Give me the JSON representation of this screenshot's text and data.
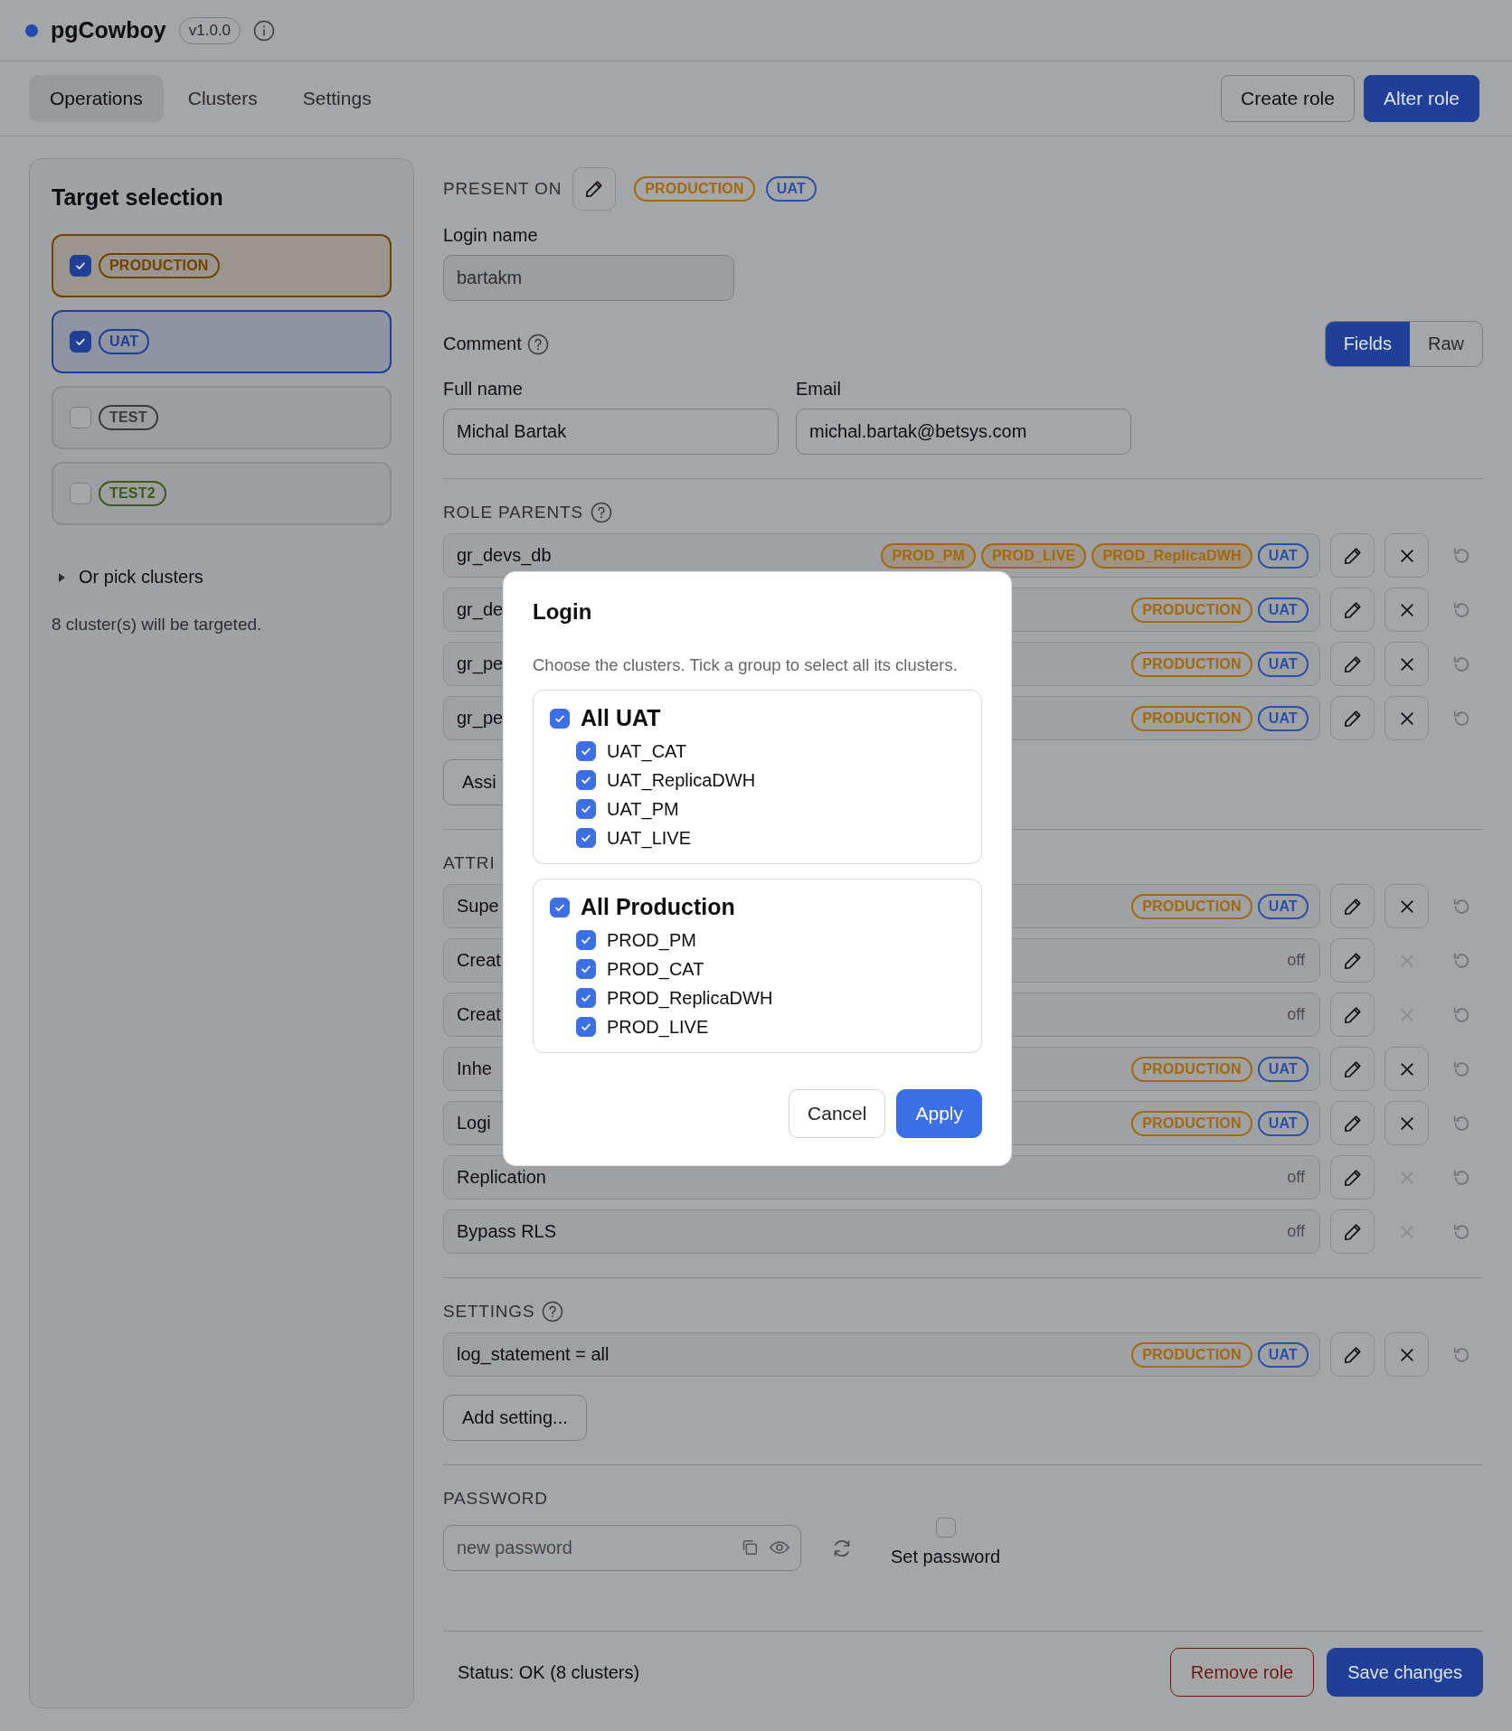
{
  "app": {
    "title": "pgCowboy",
    "version": "v1.0.0"
  },
  "tabs": [
    {
      "label": "Operations",
      "selected": true
    },
    {
      "label": "Clusters",
      "selected": false
    },
    {
      "label": "Settings",
      "selected": false
    }
  ],
  "mode_buttons": [
    {
      "label": "Create role",
      "selected": false
    },
    {
      "label": "Alter role",
      "selected": true
    }
  ],
  "target_selection": {
    "title": "Target selection",
    "groups": [
      {
        "label": "PRODUCTION",
        "color": "#704400",
        "checked": true
      },
      {
        "label": "UAT",
        "color": "#203f96",
        "checked": true
      },
      {
        "label": "TEST",
        "color": "#3a3c40",
        "checked": false
      },
      {
        "label": "TEST2",
        "color": "#3f5a18",
        "checked": false
      }
    ],
    "pick_clusters": {
      "label": "Or pick clusters",
      "expanded": false
    },
    "summary": "8 cluster(s) will be targeted."
  },
  "role": {
    "present_on": {
      "label": "PRESENT ON",
      "tags": [
        {
          "label": "PRODUCTION",
          "color": "#a2690c",
          "kind": "outline"
        },
        {
          "label": "UAT",
          "color": "#2b4fa6",
          "kind": "outline"
        }
      ]
    },
    "login_name": {
      "label": "Login name",
      "value": "bartakm"
    },
    "comment": {
      "label": "Comment",
      "has_help": true,
      "view": [
        {
          "label": "Fields",
          "selected": true
        },
        {
          "label": "Raw",
          "selected": false
        }
      ]
    },
    "full_name": {
      "label": "Full name",
      "value": "Michal Bartak"
    },
    "email": {
      "label": "Email",
      "value": "michal.bartak@betsys.com"
    },
    "role_parents": {
      "title": "ROLE PARENTS",
      "has_help": true,
      "add_button": "Assi",
      "rows": [
        {
          "name": "gr_devs_db",
          "tags": [
            {
              "label": "PROD_PM",
              "color": "#a2690c",
              "kind": "filled"
            },
            {
              "label": "PROD_LIVE",
              "color": "#a2690c",
              "kind": "filled"
            },
            {
              "label": "PROD_ReplicaDWH",
              "color": "#a2690c",
              "kind": "filled"
            },
            {
              "label": "UAT",
              "color": "#2b4fa6",
              "kind": "outline"
            }
          ],
          "removable": true,
          "revertable": false
        },
        {
          "name": "gr_de",
          "tags": [
            {
              "label": "PRODUCTION",
              "color": "#a2690c",
              "kind": "outline"
            },
            {
              "label": "UAT",
              "color": "#2b4fa6",
              "kind": "outline"
            }
          ],
          "removable": true,
          "revertable": false
        },
        {
          "name": "gr_pe",
          "tags": [
            {
              "label": "PRODUCTION",
              "color": "#a2690c",
              "kind": "outline"
            },
            {
              "label": "UAT",
              "color": "#2b4fa6",
              "kind": "outline"
            }
          ],
          "removable": true,
          "revertable": false
        },
        {
          "name": "gr_pe",
          "tags": [
            {
              "label": "PRODUCTION",
              "color": "#a2690c",
              "kind": "outline"
            },
            {
              "label": "UAT",
              "color": "#2b4fa6",
              "kind": "outline"
            }
          ],
          "removable": true,
          "revertable": false
        }
      ]
    },
    "attributes": {
      "title": "ATTRI",
      "rows": [
        {
          "name": "Supe",
          "tags": [
            {
              "label": "PRODUCTION",
              "color": "#a2690c",
              "kind": "outline"
            },
            {
              "label": "UAT",
              "color": "#2b4fa6",
              "kind": "outline"
            }
          ],
          "removable": true,
          "revertable": false
        },
        {
          "name": "Creat",
          "status": "off",
          "removable": false,
          "revertable": false
        },
        {
          "name": "Creat",
          "status": "off",
          "removable": false,
          "revertable": false
        },
        {
          "name": "Inhe",
          "tags": [
            {
              "label": "PRODUCTION",
              "color": "#a2690c",
              "kind": "outline"
            },
            {
              "label": "UAT",
              "color": "#2b4fa6",
              "kind": "outline"
            }
          ],
          "removable": true,
          "revertable": false
        },
        {
          "name": "Logi",
          "tags": [
            {
              "label": "PRODUCTION",
              "color": "#a2690c",
              "kind": "outline"
            },
            {
              "label": "UAT",
              "color": "#2b4fa6",
              "kind": "outline"
            }
          ],
          "removable": true,
          "revertable": false
        },
        {
          "name": "Replication",
          "status": "off",
          "removable": false,
          "revertable": false
        },
        {
          "name": "Bypass RLS",
          "status": "off",
          "removable": false,
          "revertable": false
        }
      ]
    },
    "settings": {
      "title": "SETTINGS",
      "has_help": true,
      "add_button": "Add setting...",
      "rows": [
        {
          "name": "log_statement = all",
          "tags": [
            {
              "label": "PRODUCTION",
              "color": "#a2690c",
              "kind": "outline"
            },
            {
              "label": "UAT",
              "color": "#2b4fa6",
              "kind": "outline"
            }
          ],
          "removable": true,
          "revertable": false
        }
      ]
    },
    "password": {
      "title": "PASSWORD",
      "placeholder": "new password",
      "set_password": {
        "label": "Set password",
        "checked": false
      }
    },
    "footer": {
      "status": "Status: OK (8 clusters)",
      "buttons": [
        {
          "label": "Remove role",
          "kind": "danger"
        },
        {
          "label": "Save changes",
          "kind": "primary"
        }
      ]
    }
  },
  "dialog": {
    "title": "Login",
    "description": "Choose the clusters. Tick a group to select all its clusters.",
    "groups": [
      {
        "label": "All UAT",
        "checked": true,
        "children": [
          {
            "label": "UAT_CAT",
            "checked": true
          },
          {
            "label": "UAT_ReplicaDWH",
            "checked": true
          },
          {
            "label": "UAT_PM",
            "checked": true
          },
          {
            "label": "UAT_LIVE",
            "checked": true
          }
        ]
      },
      {
        "label": "All Production",
        "checked": true,
        "children": [
          {
            "label": "PROD_PM",
            "checked": true
          },
          {
            "label": "PROD_CAT",
            "checked": true
          },
          {
            "label": "PROD_ReplicaDWH",
            "checked": true
          },
          {
            "label": "PROD_LIVE",
            "checked": true
          }
        ]
      }
    ],
    "buttons": [
      {
        "label": "Cancel",
        "kind": "secondary"
      },
      {
        "label": "Apply",
        "kind": "primary"
      }
    ]
  }
}
